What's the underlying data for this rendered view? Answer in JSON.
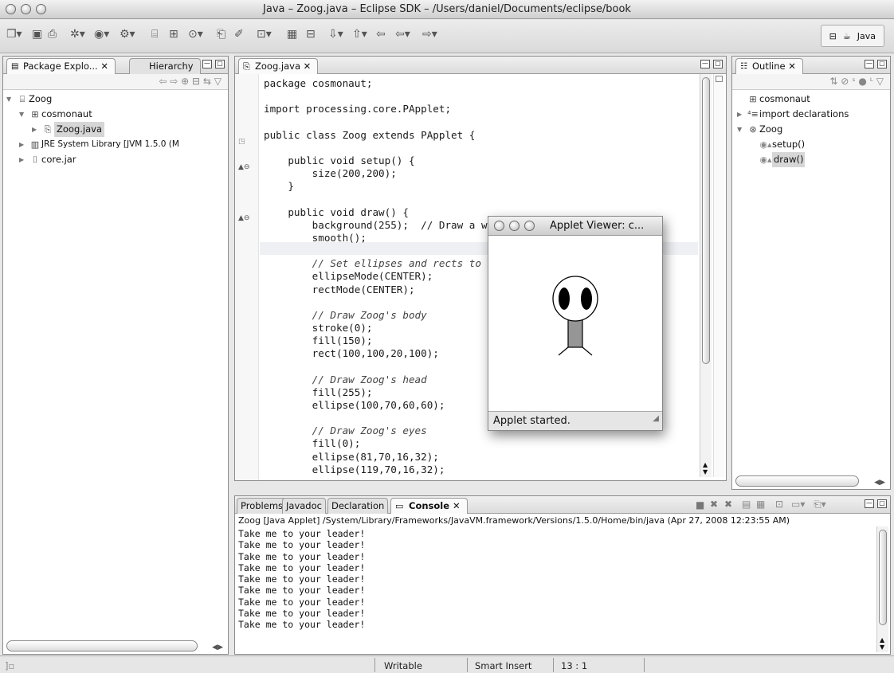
{
  "window": {
    "title": "Java – Zoog.java – Eclipse SDK – /Users/daniel/Documents/eclipse/book"
  },
  "toolbar": {
    "perspective_label": "Java"
  },
  "left_panel": {
    "tabs": [
      {
        "label": "Package Explo... ✕"
      },
      {
        "label": "Hierarchy"
      }
    ],
    "tree": [
      {
        "label": "Zoog",
        "icon": "project-icon",
        "expanded": true,
        "depth": 0
      },
      {
        "label": "cosmonaut",
        "icon": "package-icon",
        "expanded": true,
        "depth": 1
      },
      {
        "label": "Zoog.java",
        "icon": "java-file-icon",
        "expanded": false,
        "depth": 2
      },
      {
        "label": "JRE System Library [JVM 1.5.0 (M",
        "icon": "library-icon",
        "expanded": false,
        "depth": 1
      },
      {
        "label": "core.jar",
        "icon": "jar-icon",
        "expanded": false,
        "depth": 1
      }
    ]
  },
  "editor": {
    "tab_label": "Zoog.java ✕",
    "lines": [
      {
        "text": "package cosmonaut;",
        "comment": false
      },
      {
        "text": "",
        "comment": false
      },
      {
        "text": "import processing.core.PApplet;",
        "comment": false
      },
      {
        "text": "",
        "comment": false
      },
      {
        "text": "public class Zoog extends PApplet {",
        "comment": false
      },
      {
        "text": "",
        "comment": false
      },
      {
        "text": "    public void setup() {",
        "comment": false
      },
      {
        "text": "        size(200,200);",
        "comment": false
      },
      {
        "text": "    }",
        "comment": false
      },
      {
        "text": "",
        "comment": false
      },
      {
        "text": "    public void draw() {",
        "comment": false
      },
      {
        "text": "        background(255);  // Draw a w",
        "comment": false
      },
      {
        "text": "        smooth();",
        "comment": false
      },
      {
        "text": "",
        "comment": false
      },
      {
        "text": "        // Set ellipses and rects to",
        "comment": true
      },
      {
        "text": "        ellipseMode(CENTER);",
        "comment": false
      },
      {
        "text": "        rectMode(CENTER);",
        "comment": false
      },
      {
        "text": "",
        "comment": false
      },
      {
        "text": "        // Draw Zoog's body",
        "comment": true
      },
      {
        "text": "        stroke(0);",
        "comment": false
      },
      {
        "text": "        fill(150);",
        "comment": false
      },
      {
        "text": "        rect(100,100,20,100);",
        "comment": false
      },
      {
        "text": "",
        "comment": false
      },
      {
        "text": "        // Draw Zoog's head",
        "comment": true
      },
      {
        "text": "        fill(255);",
        "comment": false
      },
      {
        "text": "        ellipse(100,70,60,60);",
        "comment": false
      },
      {
        "text": "",
        "comment": false
      },
      {
        "text": "        // Draw Zoog's eyes",
        "comment": true
      },
      {
        "text": "        fill(0);",
        "comment": false
      },
      {
        "text": "        ellipse(81,70,16,32);",
        "comment": false
      },
      {
        "text": "        ellipse(119,70,16,32);",
        "comment": false
      }
    ]
  },
  "applet": {
    "title": "Applet Viewer: c...",
    "status": "Applet started."
  },
  "outline": {
    "tab_label": "Outline ✕",
    "items": [
      {
        "label": "cosmonaut",
        "icon": "package-icon",
        "depth": 0
      },
      {
        "label": "import declarations",
        "icon": "imports-icon",
        "depth": 0
      },
      {
        "label": "Zoog",
        "icon": "class-icon",
        "depth": 0
      },
      {
        "label": "setup()",
        "icon": "method-icon",
        "depth": 1
      },
      {
        "label": "draw()",
        "icon": "method-icon",
        "depth": 1
      }
    ]
  },
  "bottom_panel": {
    "tabs": [
      {
        "label": "Problems"
      },
      {
        "label": "Javadoc"
      },
      {
        "label": "Declaration"
      },
      {
        "label": "Console ✕"
      }
    ],
    "console_header": "Zoog [Java Applet] /System/Library/Frameworks/JavaVM.framework/Versions/1.5.0/Home/bin/java (Apr 27, 2008 12:23:55 AM)",
    "console_line": "Take me to your leader!",
    "console_line_count": 9
  },
  "statusbar": {
    "writable": "Writable",
    "insert_mode": "Smart Insert",
    "position": "13 : 1"
  }
}
